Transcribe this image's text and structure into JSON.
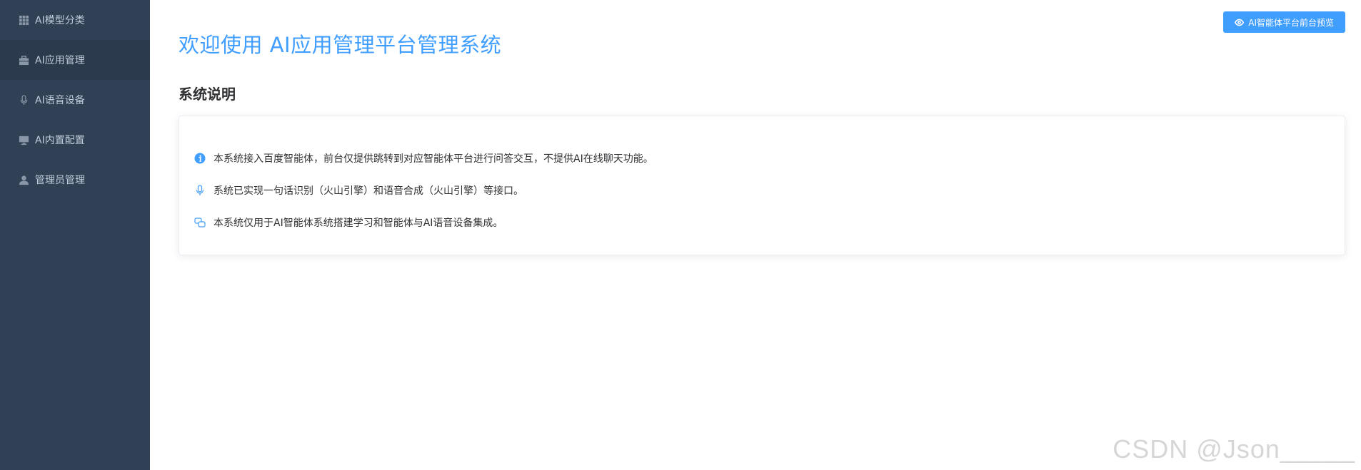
{
  "sidebar": {
    "items": [
      {
        "label": "AI模型分类",
        "icon": "grid-icon"
      },
      {
        "label": "AI应用管理",
        "icon": "briefcase-icon",
        "active": true
      },
      {
        "label": "AI语音设备",
        "icon": "microphone-icon"
      },
      {
        "label": "AI内置配置",
        "icon": "monitor-icon"
      },
      {
        "label": "管理员管理",
        "icon": "user-icon"
      }
    ]
  },
  "header": {
    "preview_label": "AI智能体平台前台预览",
    "preview_icon": "eye-icon"
  },
  "main": {
    "title": "欢迎使用 AI应用管理平台管理系统",
    "section_title": "系统说明",
    "info_lines": [
      {
        "text": "本系统接入百度智能体，前台仅提供跳转到对应智能体平台进行问答交互，不提供AI在线聊天功能。",
        "icon": "info-circle-icon"
      },
      {
        "text": "系统已实现一句话识别（火山引擎）和语音合成（火山引擎）等接口。",
        "icon": "microphone-icon"
      },
      {
        "text": "本系统仅用于AI智能体系统搭建学习和智能体与AI语音设备集成。",
        "icon": "chat-icon"
      }
    ]
  },
  "watermark": "CSDN @Json_____",
  "colors": {
    "sidebar_bg": "#304156",
    "sidebar_active_bg": "#2b3a4d",
    "sidebar_text": "#bfcbd9",
    "accent": "#409eff",
    "text_primary": "#303133"
  }
}
